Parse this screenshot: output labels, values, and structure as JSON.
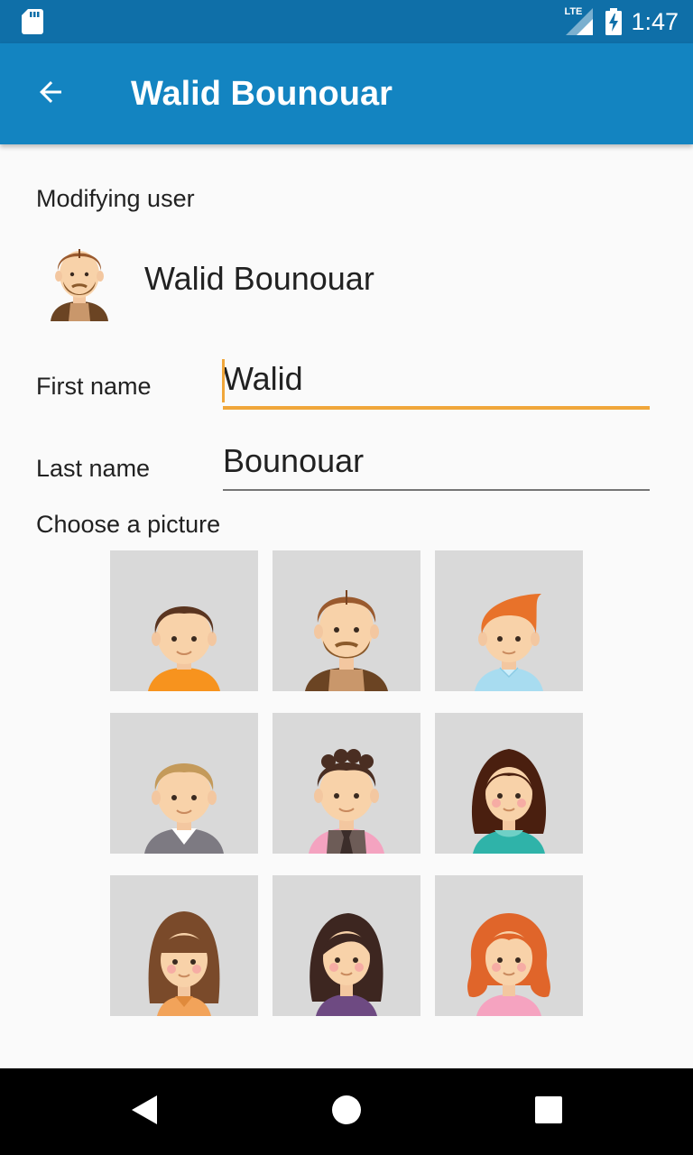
{
  "status_bar": {
    "time": "1:47",
    "network": "LTE",
    "icons": [
      "sd-card-icon",
      "lte-signal-icon",
      "battery-charging-icon"
    ]
  },
  "app_bar": {
    "title": "Walid Bounouar",
    "back_icon": "arrow-back-icon",
    "color": "#1384c1"
  },
  "modifying": {
    "label": "Modifying user",
    "user_name": "Walid Bounouar"
  },
  "form": {
    "first_name_label": "First name",
    "first_name_value": "Walid",
    "last_name_label": "Last name",
    "last_name_value": "Bounouar",
    "accent_color": "#f0a63a"
  },
  "picture_picker": {
    "label": "Choose a picture",
    "avatars": [
      "boy-brown-hair-orange-shirt",
      "man-beard-brown-vest",
      "boy-orange-hair-blue-shirt",
      "man-blond-grey-sweater",
      "man-curly-hair-pink-shirt-tie",
      "girl-dark-hair-teal-hoodie",
      "girl-long-brown-hair-orange-top",
      "girl-dark-hair-purple-top",
      "girl-red-curly-hair-pink-top"
    ]
  },
  "nav_bar": {
    "icons": [
      "nav-back-icon",
      "nav-home-icon",
      "nav-recents-icon"
    ]
  }
}
